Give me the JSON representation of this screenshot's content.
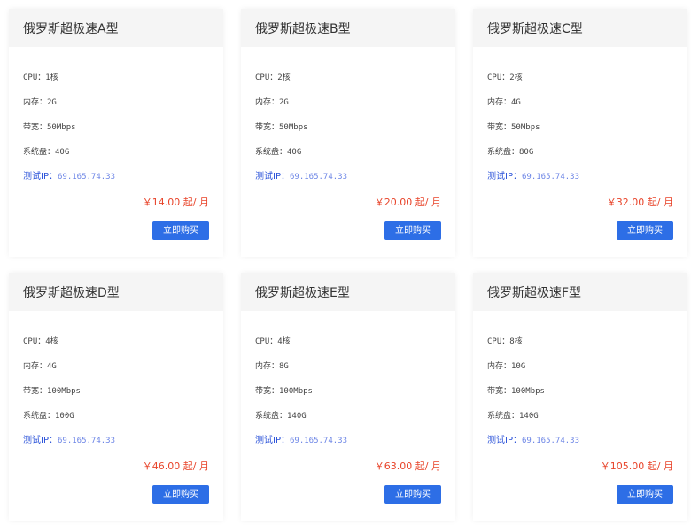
{
  "plans": [
    {
      "title": "俄罗斯超极速A型",
      "cpu_label": "CPU：",
      "cpu": "1核",
      "ram_label": "内存：",
      "ram": "2G",
      "bw_label": "带宽：",
      "bw": "50Mbps",
      "disk_label": "系统盘：",
      "disk": "40G",
      "ip_label": "测试IP：",
      "ip": "69.165.74.33",
      "price": "￥14.00 起/ 月",
      "buy": "立即购买"
    },
    {
      "title": "俄罗斯超极速B型",
      "cpu_label": "CPU：",
      "cpu": "2核",
      "ram_label": "内存：",
      "ram": "2G",
      "bw_label": "带宽：",
      "bw": "50Mbps",
      "disk_label": "系统盘：",
      "disk": "40G",
      "ip_label": "测试IP：",
      "ip": "69.165.74.33",
      "price": "￥20.00 起/ 月",
      "buy": "立即购买"
    },
    {
      "title": "俄罗斯超极速C型",
      "cpu_label": "CPU：",
      "cpu": "2核",
      "ram_label": "内存：",
      "ram": "4G",
      "bw_label": "带宽：",
      "bw": "50Mbps",
      "disk_label": "系统盘：",
      "disk": "80G",
      "ip_label": "测试IP：",
      "ip": "69.165.74.33",
      "price": "￥32.00 起/ 月",
      "buy": "立即购买"
    },
    {
      "title": "俄罗斯超极速D型",
      "cpu_label": "CPU：",
      "cpu": "4核",
      "ram_label": "内存：",
      "ram": "4G",
      "bw_label": "带宽：",
      "bw": "100Mbps",
      "disk_label": "系统盘：",
      "disk": "100G",
      "ip_label": "测试IP：",
      "ip": "69.165.74.33",
      "price": "￥46.00 起/ 月",
      "buy": "立即购买"
    },
    {
      "title": "俄罗斯超极速E型",
      "cpu_label": "CPU：",
      "cpu": "4核",
      "ram_label": "内存：",
      "ram": "8G",
      "bw_label": "带宽：",
      "bw": "100Mbps",
      "disk_label": "系统盘：",
      "disk": "140G",
      "ip_label": "测试IP：",
      "ip": "69.165.74.33",
      "price": "￥63.00 起/ 月",
      "buy": "立即购买"
    },
    {
      "title": "俄罗斯超极速F型",
      "cpu_label": "CPU：",
      "cpu": "8核",
      "ram_label": "内存：",
      "ram": "10G",
      "bw_label": "带宽：",
      "bw": "100Mbps",
      "disk_label": "系统盘：",
      "disk": "140G",
      "ip_label": "测试IP：",
      "ip": "69.165.74.33",
      "price": "￥105.00 起/ 月",
      "buy": "立即购买"
    }
  ],
  "colors": {
    "accent": "#2d6ee6",
    "price": "#e8442a",
    "ip": "#4a6cf7",
    "header_bg": "#f5f5f5"
  }
}
